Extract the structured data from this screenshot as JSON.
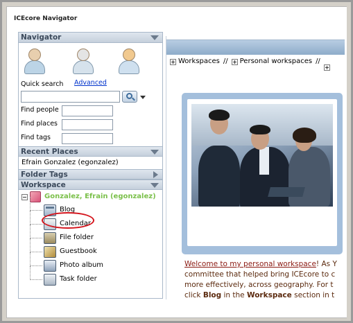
{
  "window": {
    "title": "ICEcore Navigator"
  },
  "navigator": {
    "header": "Navigator",
    "quick_search_label": "Quick search",
    "advanced_link": "Advanced",
    "find_people": "Find people",
    "find_places": "Find places",
    "find_tags": "Find tags"
  },
  "recent_places": {
    "header": "Recent Places",
    "items": [
      "Efrain Gonzalez (egonzalez)"
    ]
  },
  "folder_tags": {
    "header": "Folder Tags"
  },
  "workspace_tree": {
    "header": "Workspace",
    "root": "Gonzalez, Efrain (egonzalez)",
    "items": [
      {
        "label": "Blog",
        "icon": "blog-folder-icon"
      },
      {
        "label": "Calendar",
        "icon": "calendar-folder-icon"
      },
      {
        "label": "File folder",
        "icon": "file-folder-icon"
      },
      {
        "label": "Guestbook",
        "icon": "guestbook-folder-icon"
      },
      {
        "label": "Photo album",
        "icon": "photo-album-folder-icon"
      },
      {
        "label": "Task folder",
        "icon": "task-folder-icon"
      }
    ]
  },
  "content": {
    "breadcrumbs": [
      "Workspaces",
      "Personal workspaces"
    ],
    "breadcrumb_separator": "//",
    "welcome_link": "Welcome to my personal workspace",
    "welcome_rest": "! As Y",
    "line2": "committee that helped bring ICEcore to c",
    "line3": "more effectively, across geography. For t",
    "line4_a": "click ",
    "line4_bold1": "Blog",
    "line4_b": " in the ",
    "line4_bold2": "Workspace",
    "line4_c": " section in t"
  },
  "colors": {
    "header_bg": "#c5d0dc",
    "root_label": "#7bc04a",
    "link": "#0033cc",
    "welcome_text": "#5b2a0e",
    "highlight_ring": "#d4141c",
    "photo_frame": "#a4bfdc"
  }
}
